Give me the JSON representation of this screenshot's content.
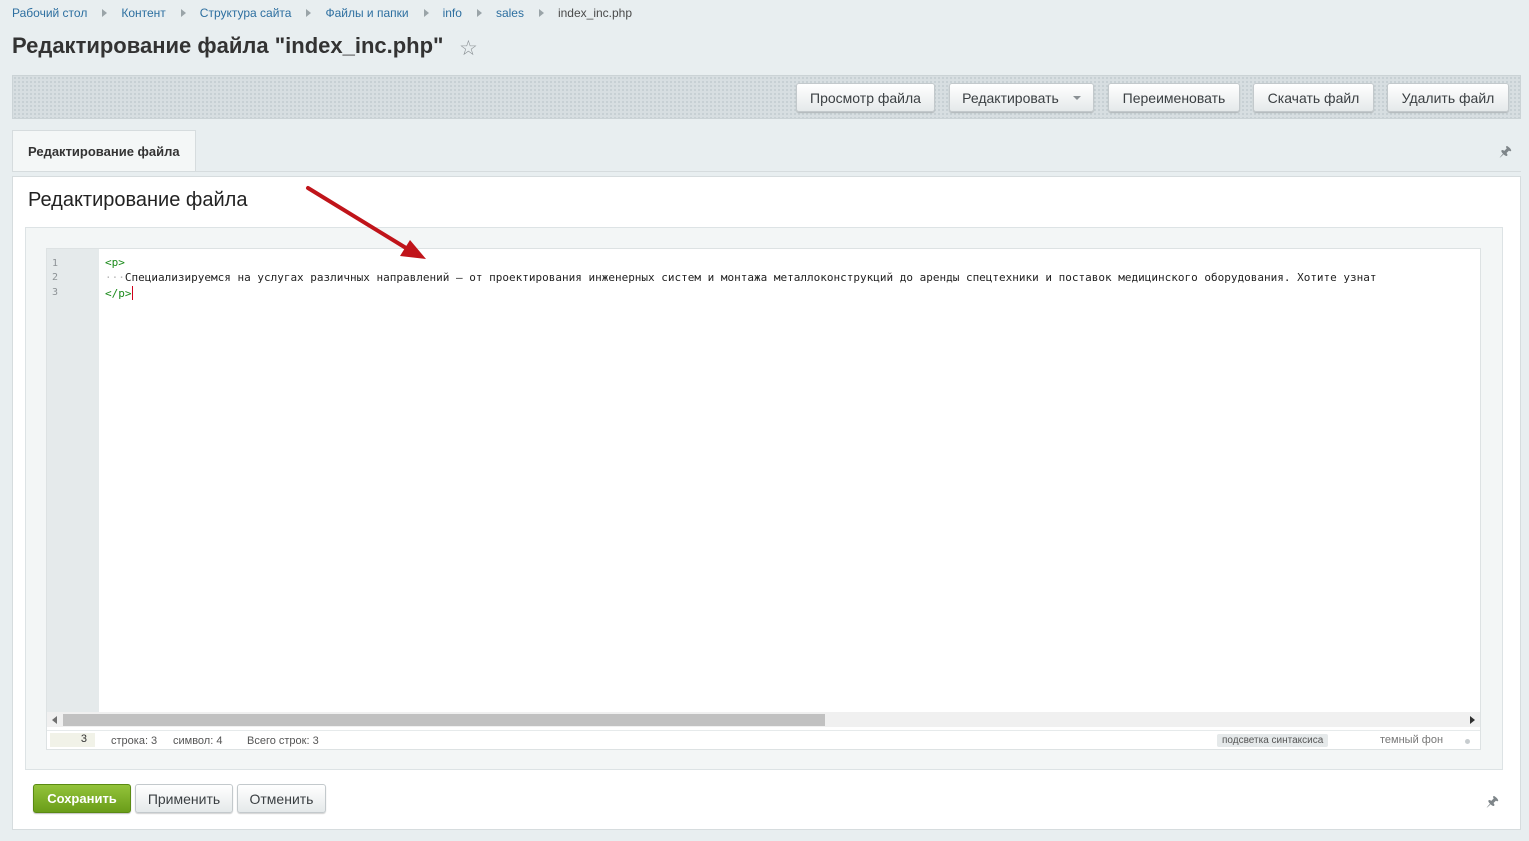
{
  "breadcrumbs": [
    "Рабочий стол",
    "Контент",
    "Структура сайта",
    "Файлы и папки",
    "info",
    "sales",
    "index_inc.php"
  ],
  "page_title": "Редактирование файла \"index_inc.php\"",
  "toolbar": {
    "view_file": "Просмотр файла",
    "edit": "Редактировать",
    "rename": "Переименовать",
    "download": "Скачать файл",
    "delete": "Удалить файл"
  },
  "tabs": [
    {
      "label": "Редактирование файла"
    }
  ],
  "section_title": "Редактирование файла",
  "editor": {
    "line_numbers": [
      "1",
      "2",
      "3"
    ],
    "line1": "<p>",
    "line2_indent": "···",
    "line2_text": "Специализируемся на услугах различных направлений — от проектирования инженерных систем и монтажа металлоконструкций до аренды спецтехники и поставок медицинского оборудования. Хотите узнат",
    "line3": "</p>"
  },
  "status": {
    "current_line_field": "3",
    "line": "строка: 3",
    "symbol": "символ: 4",
    "total_lines": "Всего строк: 3",
    "syntax_highlight": "подсветка синтаксиса",
    "dark_background": "темный фон"
  },
  "footer": {
    "save": "Сохранить",
    "apply": "Применить",
    "cancel": "Отменить"
  },
  "colors": {
    "accent_green": "#6a9d19",
    "link_blue": "#2d6fa0",
    "annotation_arrow": "#c0141a",
    "code_tag": "#1a8a1a"
  }
}
